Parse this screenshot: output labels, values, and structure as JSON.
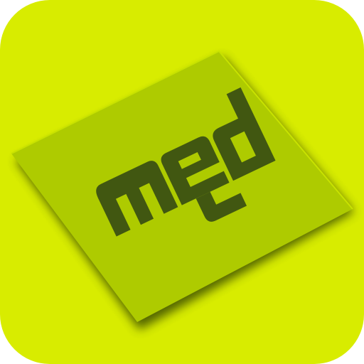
{
  "app_icon": {
    "logo_text": "med",
    "colors": {
      "background": "#d8ec00",
      "card": "#aecb00",
      "card_edge": "#c8e200",
      "shadow": "#344600",
      "logo": "#415711"
    }
  }
}
